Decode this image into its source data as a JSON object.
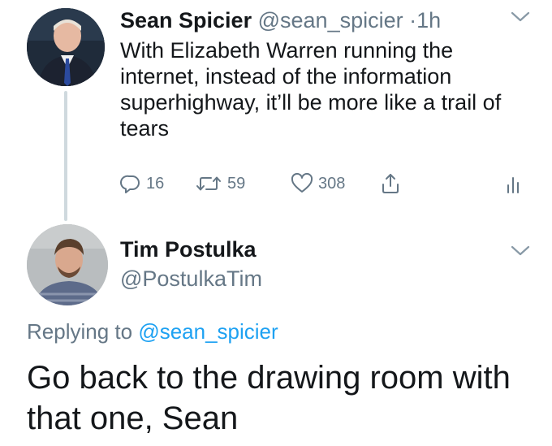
{
  "parent_tweet": {
    "display_name": "Sean Spicier",
    "handle": "@sean_spicier",
    "separator": "·",
    "time": "1h",
    "text": "With Elizabeth Warren running the internet, instead of the information superhighway, it’ll be more like a trail of tears",
    "actions": {
      "reply_count": "16",
      "retweet_count": "59",
      "like_count": "308"
    },
    "icons": {
      "avatar": "avatar-photo",
      "chevron": "chevron-down-icon",
      "reply": "reply-icon",
      "retweet": "retweet-icon",
      "like": "heart-icon",
      "share": "share-icon",
      "analytics": "analytics-icon"
    }
  },
  "reply_tweet": {
    "display_name": "Tim Postulka",
    "handle": "@PostulkaTim",
    "replying_prefix": "Replying to",
    "replying_handle": "@sean_spicier",
    "text": "Go back to the drawing room with that one, Sean"
  },
  "colors": {
    "text_primary": "#14171a",
    "text_secondary": "#657786",
    "link": "#1da1f2",
    "thread_line": "#cfd9de",
    "icon": "#657786"
  }
}
